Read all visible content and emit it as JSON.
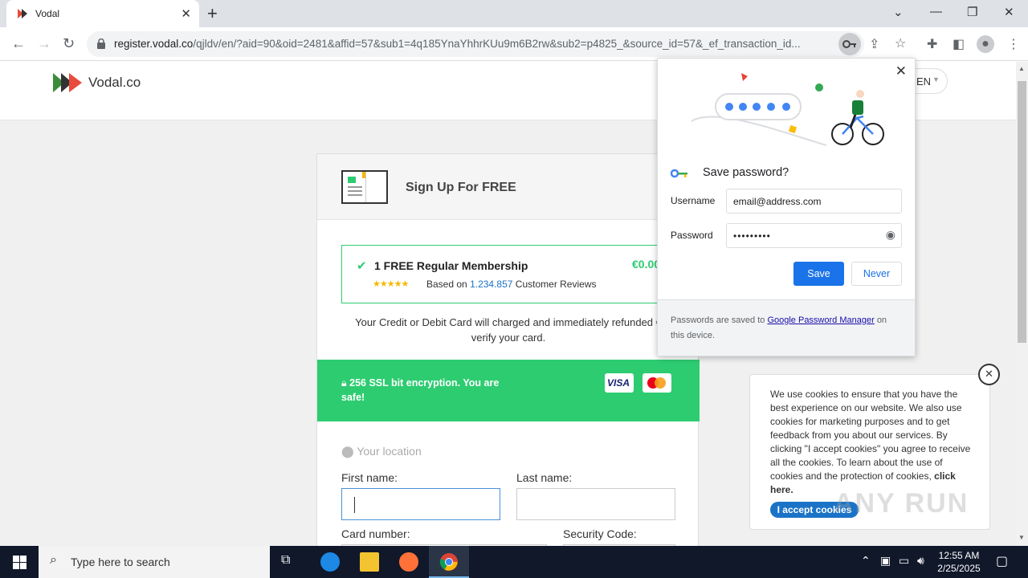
{
  "browser": {
    "tab_title": "Vodal",
    "url_host": "register.vodal.co",
    "url_path": "/qjldv/en/?aid=90&oid=2481&affid=57&sub1=4q185YnaYhhrKUu9m6B2rw&sub2=p4825_&source_id=57&_ef_transaction_id..."
  },
  "site": {
    "logo_text": "Vodal.co",
    "language": "EN"
  },
  "signup": {
    "heading": "Sign Up For FREE",
    "offer_name": "1 FREE Regular Membership",
    "offer_price": "€0.00",
    "stars": "★★★★★",
    "reviews_prefix": "Based on",
    "reviews_count": "1.234.857",
    "reviews_suffix": "Customer Reviews",
    "refund_line1": "Your Credit or Debit Card will charged and immediately refunded €",
    "refund_line2": "verify your card.",
    "ssl_text": "256 SSL bit encryption. You are safe!",
    "visa": "VISA",
    "location_placeholder": "Your location",
    "first_name_label": "First name:",
    "last_name_label": "Last name:",
    "card_number_label": "Card number:",
    "security_code_label": "Security Code:"
  },
  "password_popup": {
    "title": "Save password?",
    "username_label": "Username",
    "username_value": "email@address.com",
    "password_label": "Password",
    "password_value": "•••••••••",
    "save_label": "Save",
    "never_label": "Never",
    "footer_prefix": "Passwords are saved to",
    "footer_link": "Google Password Manager",
    "footer_suffix": "on this device."
  },
  "cookie": {
    "text": "We use cookies to ensure that you have the best experience on our website. We also use cookies for marketing purposes and to get feedback from you about our services. By clicking \"I accept cookies\" you agree to receive all the cookies. To learn about the use of cookies and the protection of cookies,",
    "link": "click here.",
    "accept_label": "I accept cookies"
  },
  "taskbar": {
    "search_placeholder": "Type here to search",
    "time": "12:55 AM",
    "date": "2/25/2025"
  },
  "watermark": "ANY RUN",
  "colors": {
    "green": "#2ecc71",
    "blue_button": "#1a73e8",
    "taskbar": "#10182a"
  }
}
